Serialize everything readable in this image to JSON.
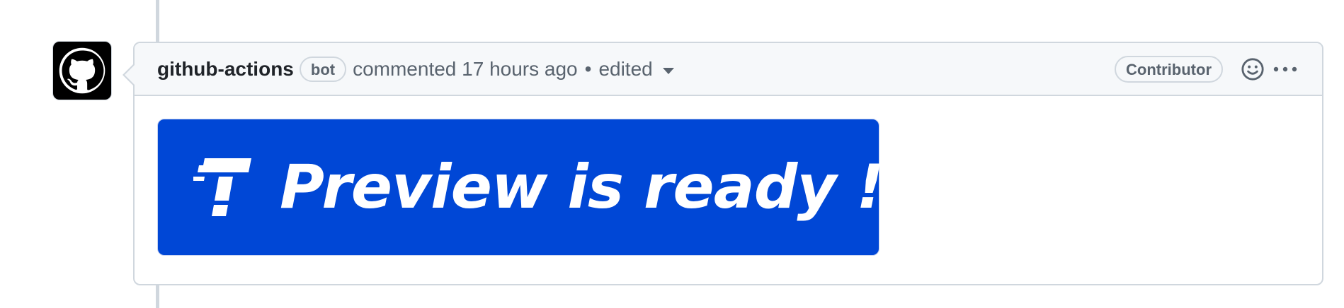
{
  "comment": {
    "author": "github-actions",
    "author_badge": "bot",
    "action": "commented",
    "time": "17 hours ago",
    "separator": "•",
    "edited_label": "edited",
    "role_label": "Contributor",
    "body": {
      "banner_text": "Preview is ready !",
      "banner_color": "#0047d6"
    }
  },
  "icons": {
    "avatar": "github-octocat-icon",
    "edited_dropdown": "triangle-down-icon",
    "reaction": "smiley-icon",
    "more": "kebab-horizontal-icon"
  },
  "colors": {
    "border": "#d0d7de",
    "header_bg": "#f6f8fa",
    "muted_text": "#59636e"
  }
}
